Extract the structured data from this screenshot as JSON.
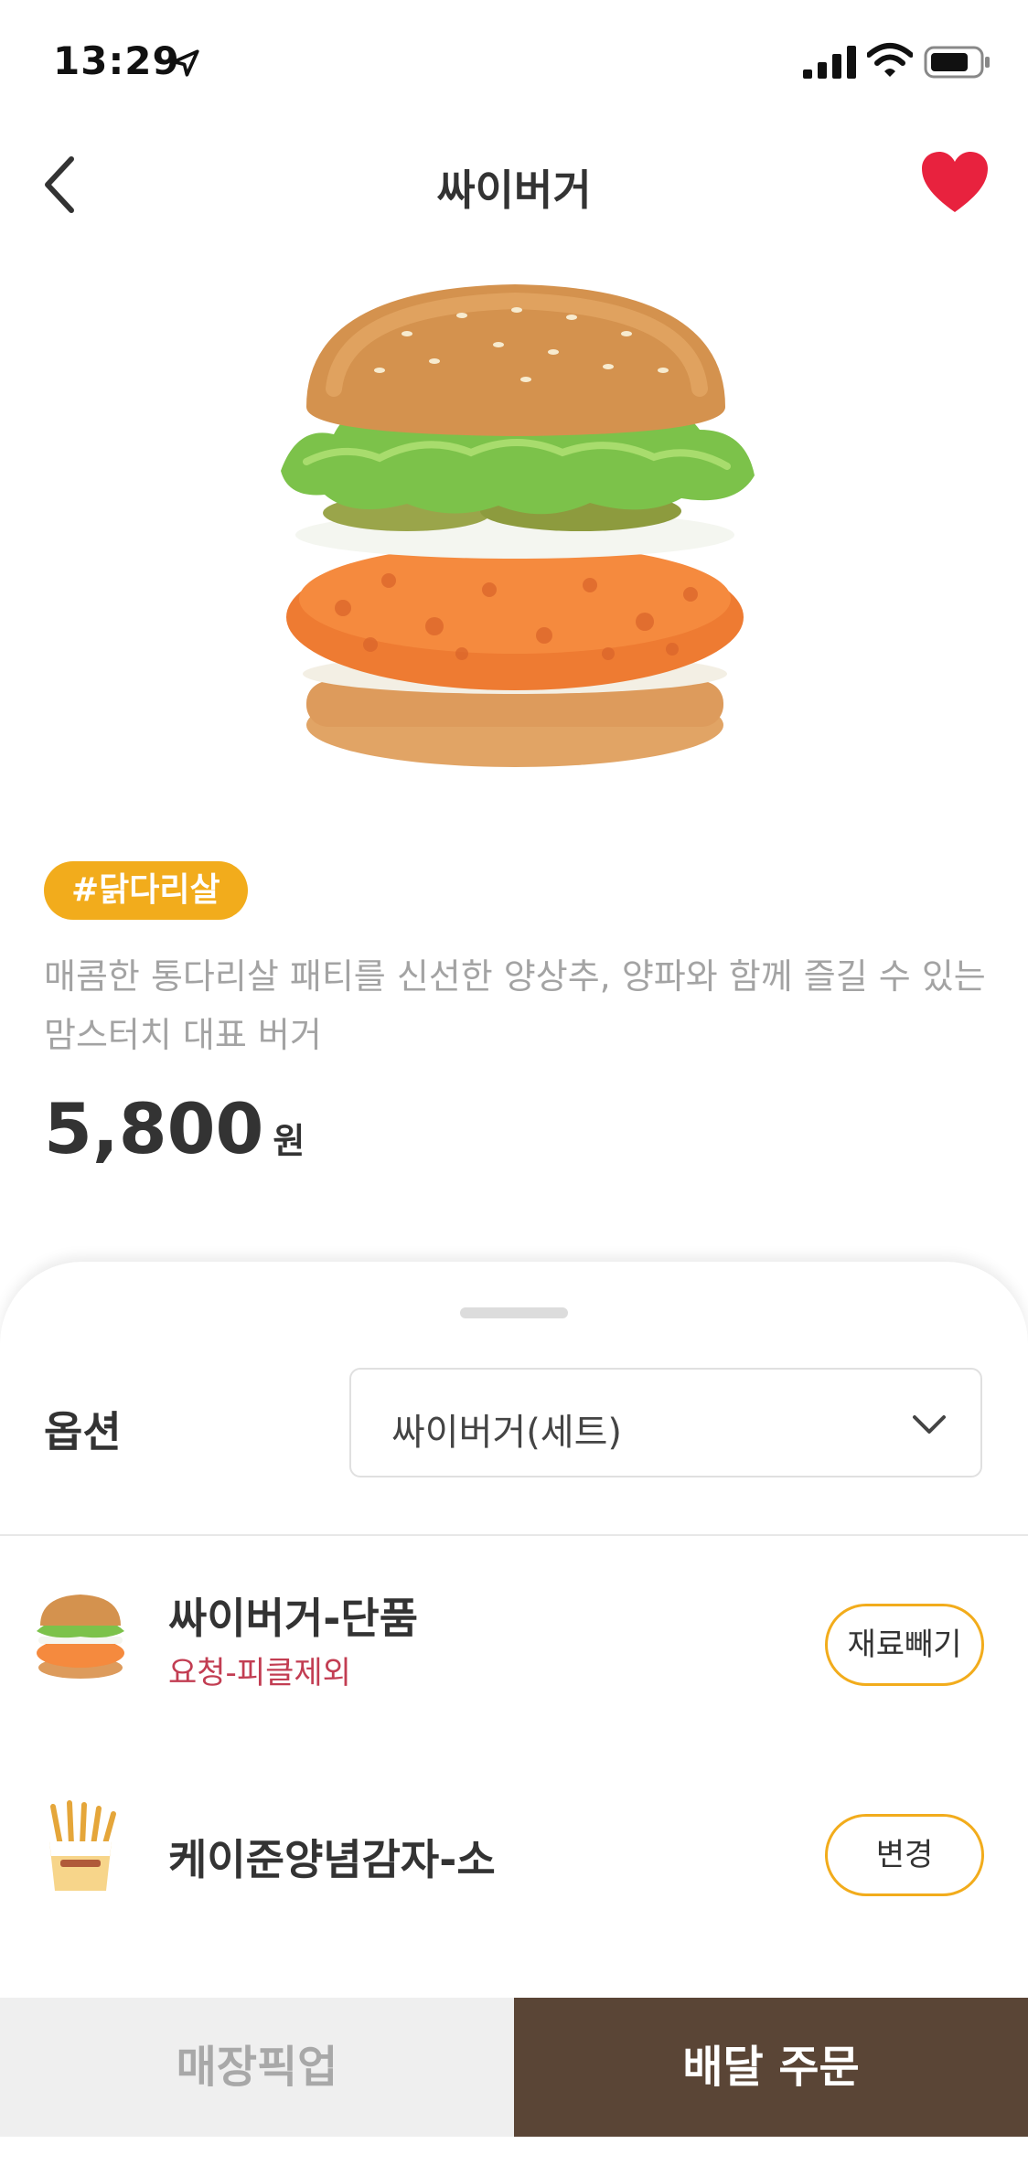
{
  "status_bar": {
    "time": "13:29"
  },
  "header": {
    "title": "싸이버거",
    "favorited": true,
    "favorite_color": "#e8223e"
  },
  "product": {
    "tag": "#닭다리살",
    "description": "매콤한 통다리살 패티를 신선한 양상추, 양파와 함께 즐길 수 있는 맘스터치 대표 버거",
    "price": "5,800",
    "price_unit": "원"
  },
  "options": {
    "label": "옵션",
    "selected": "싸이버거(세트)",
    "items": [
      {
        "name": "싸이버거-단품",
        "note": "요청-피클제외",
        "action": "재료빼기",
        "icon": "burger-icon"
      },
      {
        "name": "케이준양념감자-소",
        "note": "",
        "action": "변경",
        "icon": "fries-icon"
      }
    ]
  },
  "bottom_bar": {
    "pickup": "매장픽업",
    "delivery": "배달 주문"
  },
  "colors": {
    "accent": "#f2ac1c",
    "brown": "#5a4536",
    "note_red": "#c23d52"
  }
}
